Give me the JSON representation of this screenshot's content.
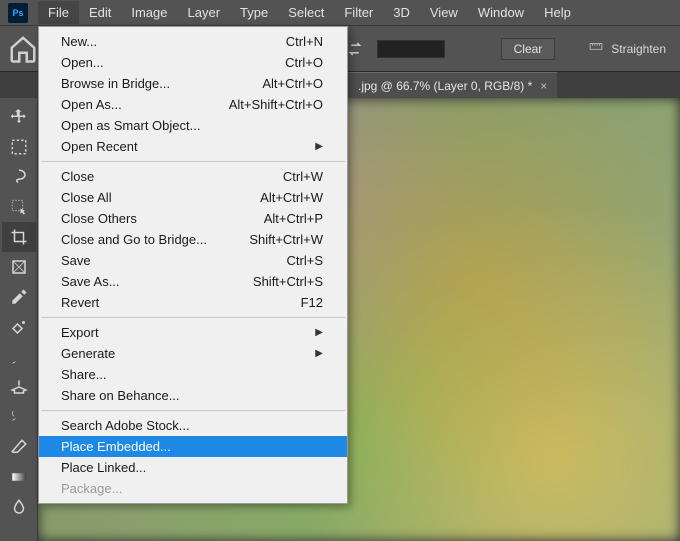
{
  "menubar": {
    "items": [
      "File",
      "Edit",
      "Image",
      "Layer",
      "Type",
      "Select",
      "Filter",
      "3D",
      "View",
      "Window",
      "Help"
    ],
    "open_index": 0
  },
  "optionsbar": {
    "clear_label": "Clear",
    "straighten_label": "Straighten"
  },
  "document_tab": {
    "title": ".jpg @ 66.7% (Layer 0, RGB/8) *"
  },
  "tools": [
    {
      "name": "move-tool"
    },
    {
      "name": "marquee-tool"
    },
    {
      "name": "lasso-tool"
    },
    {
      "name": "object-select-tool"
    },
    {
      "name": "crop-tool",
      "active": true
    },
    {
      "name": "frame-tool"
    },
    {
      "name": "eyedropper-tool"
    },
    {
      "name": "healing-brush-tool"
    },
    {
      "name": "brush-tool"
    },
    {
      "name": "clone-stamp-tool"
    },
    {
      "name": "history-brush-tool"
    },
    {
      "name": "eraser-tool"
    },
    {
      "name": "gradient-tool"
    },
    {
      "name": "blur-tool"
    }
  ],
  "file_menu": [
    {
      "label": "New...",
      "shortcut": "Ctrl+N"
    },
    {
      "label": "Open...",
      "shortcut": "Ctrl+O"
    },
    {
      "label": "Browse in Bridge...",
      "shortcut": "Alt+Ctrl+O"
    },
    {
      "label": "Open As...",
      "shortcut": "Alt+Shift+Ctrl+O"
    },
    {
      "label": "Open as Smart Object..."
    },
    {
      "label": "Open Recent",
      "submenu": true
    },
    {
      "sep": true
    },
    {
      "label": "Close",
      "shortcut": "Ctrl+W"
    },
    {
      "label": "Close All",
      "shortcut": "Alt+Ctrl+W"
    },
    {
      "label": "Close Others",
      "shortcut": "Alt+Ctrl+P"
    },
    {
      "label": "Close and Go to Bridge...",
      "shortcut": "Shift+Ctrl+W"
    },
    {
      "label": "Save",
      "shortcut": "Ctrl+S"
    },
    {
      "label": "Save As...",
      "shortcut": "Shift+Ctrl+S"
    },
    {
      "label": "Revert",
      "shortcut": "F12"
    },
    {
      "sep": true
    },
    {
      "label": "Export",
      "submenu": true
    },
    {
      "label": "Generate",
      "submenu": true
    },
    {
      "label": "Share..."
    },
    {
      "label": "Share on Behance..."
    },
    {
      "sep": true
    },
    {
      "label": "Search Adobe Stock..."
    },
    {
      "label": "Place Embedded...",
      "highlighted": true
    },
    {
      "label": "Place Linked..."
    },
    {
      "label": "Package...",
      "disabled": true
    }
  ]
}
